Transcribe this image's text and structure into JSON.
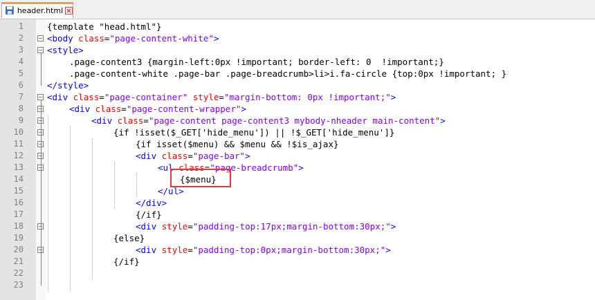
{
  "tab": {
    "filename": "header.html",
    "active_accent": "#f6a033"
  },
  "colors": {
    "tag": "#0000ff",
    "attr": "#ff0000",
    "string": "#8000ff",
    "text": "#000000",
    "highlight": "#e53935"
  },
  "lines": [
    {
      "num": "1",
      "indent": 0,
      "tokens": [
        [
          "brace",
          "{"
        ],
        [
          "text",
          "template \"head.html\""
        ],
        [
          "brace",
          "}"
        ]
      ]
    },
    {
      "num": "2",
      "indent": 0,
      "tokens": [
        [
          "tag",
          "<body"
        ],
        [
          "text",
          " "
        ],
        [
          "attr",
          "class"
        ],
        [
          "text",
          "="
        ],
        [
          "str",
          "\"page-content-white\""
        ],
        [
          "tag",
          ">"
        ]
      ]
    },
    {
      "num": "3",
      "indent": 0,
      "tokens": [
        [
          "tag",
          "<style>"
        ]
      ]
    },
    {
      "num": "4",
      "indent": 1,
      "tokens": [
        [
          "text",
          ".page-content3 {margin-left:0px !important; border-left: 0  !important;}"
        ]
      ]
    },
    {
      "num": "5",
      "indent": 1,
      "tokens": [
        [
          "text",
          ".page-content-white .page-bar .page-breadcrumb>li>i.fa-circle {top:0px !important; }"
        ]
      ]
    },
    {
      "num": "6",
      "indent": 0,
      "tokens": [
        [
          "tag",
          "</style>"
        ]
      ]
    },
    {
      "num": "7",
      "indent": 0,
      "tokens": [
        [
          "tag",
          "<div"
        ],
        [
          "text",
          " "
        ],
        [
          "attr",
          "class"
        ],
        [
          "text",
          "="
        ],
        [
          "str",
          "\"page-container\""
        ],
        [
          "text",
          " "
        ],
        [
          "attr",
          "style"
        ],
        [
          "text",
          "="
        ],
        [
          "str",
          "\"margin-bottom: 0px !important;\""
        ],
        [
          "tag",
          ">"
        ]
      ]
    },
    {
      "num": "8",
      "indent": 1,
      "tokens": [
        [
          "tag",
          "<div"
        ],
        [
          "text",
          " "
        ],
        [
          "attr",
          "class"
        ],
        [
          "text",
          "="
        ],
        [
          "str",
          "\"page-content-wrapper\""
        ],
        [
          "tag",
          ">"
        ]
      ]
    },
    {
      "num": "9",
      "indent": 2,
      "tokens": [
        [
          "tag",
          "<div"
        ],
        [
          "text",
          " "
        ],
        [
          "attr",
          "class"
        ],
        [
          "text",
          "="
        ],
        [
          "str",
          "\"page-content page-content3 mybody-nheader main-content\""
        ],
        [
          "tag",
          ">"
        ]
      ]
    },
    {
      "num": "10",
      "indent": 3,
      "tokens": [
        [
          "text",
          "{if !isset($_GET['hide_menu']) || !$_GET['hide_menu']}"
        ]
      ]
    },
    {
      "num": "11",
      "indent": 4,
      "tokens": [
        [
          "text",
          "{if isset($menu) && $menu && !$is_ajax}"
        ]
      ]
    },
    {
      "num": "12",
      "indent": 4,
      "tokens": [
        [
          "tag",
          "<div"
        ],
        [
          "text",
          " "
        ],
        [
          "attr",
          "class"
        ],
        [
          "text",
          "="
        ],
        [
          "str",
          "\"page-bar\""
        ],
        [
          "tag",
          ">"
        ]
      ]
    },
    {
      "num": "13",
      "indent": 5,
      "tokens": [
        [
          "tag",
          "<ul"
        ],
        [
          "text",
          " "
        ],
        [
          "attr",
          "class"
        ],
        [
          "text",
          "="
        ],
        [
          "str",
          "\"page-breadcrumb\""
        ],
        [
          "tag",
          ">"
        ]
      ]
    },
    {
      "num": "14",
      "indent": 6,
      "tokens": [
        [
          "text",
          "{$menu}"
        ]
      ]
    },
    {
      "num": "15",
      "indent": 5,
      "tokens": [
        [
          "tag",
          "</ul>"
        ]
      ]
    },
    {
      "num": "16",
      "indent": 4,
      "tokens": [
        [
          "tag",
          "</div>"
        ]
      ]
    },
    {
      "num": "17",
      "indent": 4,
      "tokens": [
        [
          "text",
          "{/if}"
        ]
      ]
    },
    {
      "num": "18",
      "indent": 4,
      "tokens": [
        [
          "tag",
          "<div"
        ],
        [
          "text",
          " "
        ],
        [
          "attr",
          "style"
        ],
        [
          "text",
          "="
        ],
        [
          "str",
          "\"padding-top:17px;margin-bottom:30px;\""
        ],
        [
          "tag",
          ">"
        ]
      ]
    },
    {
      "num": "19",
      "indent": 3,
      "tokens": [
        [
          "text",
          "{else}"
        ]
      ]
    },
    {
      "num": "20",
      "indent": 4,
      "tokens": [
        [
          "tag",
          "<div"
        ],
        [
          "text",
          " "
        ],
        [
          "attr",
          "style"
        ],
        [
          "text",
          "="
        ],
        [
          "str",
          "\"padding-top:0px;margin-bottom:30px;\""
        ],
        [
          "tag",
          ">"
        ]
      ]
    },
    {
      "num": "21",
      "indent": 3,
      "tokens": [
        [
          "text",
          "{/if}"
        ]
      ]
    },
    {
      "num": "22",
      "indent": 0,
      "tokens": []
    },
    {
      "num": "23",
      "indent": 0,
      "tokens": []
    }
  ]
}
